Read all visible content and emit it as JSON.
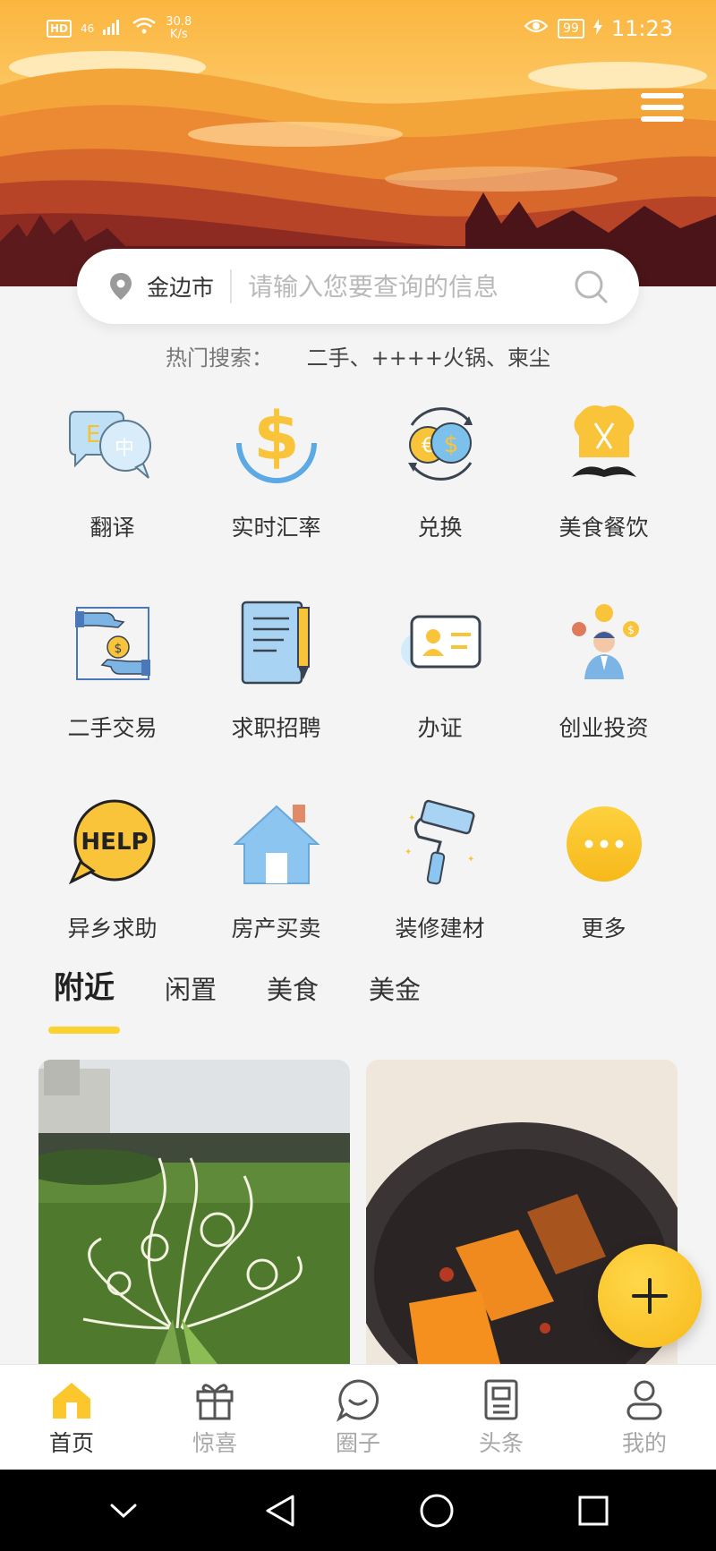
{
  "status_bar": {
    "hd": "HD",
    "network": "46",
    "speed_value": "30.8",
    "speed_unit": "K/s",
    "battery": "99",
    "time": "11:23"
  },
  "search": {
    "city": "金边市",
    "placeholder": "请输入您要查询的信息"
  },
  "hot_search": {
    "label": "热门搜索：",
    "terms": "二手、++++火锅、柬尘"
  },
  "categories": [
    {
      "label": "翻译",
      "icon": "translate-icon"
    },
    {
      "label": "实时汇率",
      "icon": "exchange-rate-icon"
    },
    {
      "label": "兑换",
      "icon": "currency-exchange-icon"
    },
    {
      "label": "美食餐饮",
      "icon": "chef-hat-icon"
    },
    {
      "label": "二手交易",
      "icon": "secondhand-trade-icon"
    },
    {
      "label": "求职招聘",
      "icon": "job-recruit-icon"
    },
    {
      "label": "办证",
      "icon": "id-card-icon"
    },
    {
      "label": "创业投资",
      "icon": "investment-icon"
    },
    {
      "label": "异乡求助",
      "icon": "help-bubble-icon"
    },
    {
      "label": "房产买卖",
      "icon": "house-icon"
    },
    {
      "label": "装修建材",
      "icon": "paint-roller-icon"
    },
    {
      "label": "更多",
      "icon": "more-icon"
    }
  ],
  "icon_help_text": "HELP",
  "feed_tabs": [
    "附近",
    "闲置",
    "美食",
    "美金"
  ],
  "bottom_nav": [
    {
      "label": "首页",
      "icon": "home-icon"
    },
    {
      "label": "惊喜",
      "icon": "gift-icon"
    },
    {
      "label": "圈子",
      "icon": "chat-icon"
    },
    {
      "label": "头条",
      "icon": "news-icon"
    },
    {
      "label": "我的",
      "icon": "profile-icon"
    }
  ],
  "colors": {
    "accent": "#fbd230",
    "fab": "#f7b91b",
    "hero_sky": "#f7b650",
    "hero_dark": "#4a1418"
  }
}
